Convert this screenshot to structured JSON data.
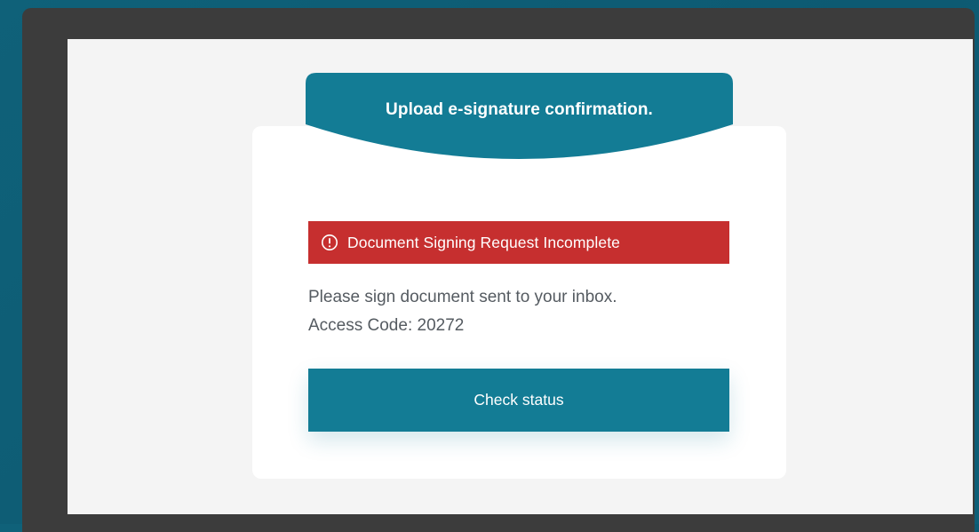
{
  "banner": {
    "title": "Upload e-signature confirmation."
  },
  "alert": {
    "icon": "alert-circle-icon",
    "text": "Document Signing Request Incomplete",
    "color": "#c62f2f"
  },
  "message": {
    "line1": "Please sign document sent to your inbox.",
    "line2": "Access Code: 20272"
  },
  "actions": {
    "check_status_label": "Check status"
  },
  "colors": {
    "accent": "#137c95",
    "page_background": "#0f6179",
    "frame": "#3c3c3c",
    "viewport": "#f4f4f4",
    "card": "#ffffff"
  }
}
